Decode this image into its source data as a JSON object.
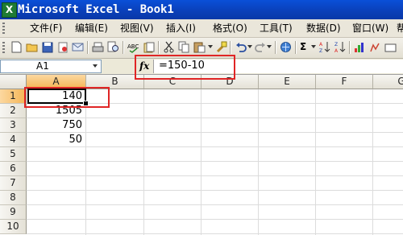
{
  "window": {
    "title": "Microsoft Excel - Book1",
    "app_icon_letter": "X"
  },
  "menu": {
    "items": [
      {
        "label": "文件(F)"
      },
      {
        "label": "编辑(E)"
      },
      {
        "label": "视图(V)"
      },
      {
        "label": "插入(I)"
      },
      {
        "label": "格式(O)"
      },
      {
        "label": "工具(T)"
      },
      {
        "label": "数据(D)"
      },
      {
        "label": "窗口(W)"
      },
      {
        "label": "帮"
      }
    ]
  },
  "toolbar": {
    "sum_symbol": "Σ"
  },
  "formula_bar": {
    "name_box": "A1",
    "fx_label": "fx",
    "formula": "=150-10"
  },
  "sheet": {
    "columns": [
      "A",
      "B",
      "C",
      "D",
      "E",
      "F",
      "G"
    ],
    "rows": [
      "1",
      "2",
      "3",
      "4",
      "5",
      "6",
      "7",
      "8",
      "9",
      "10"
    ],
    "cells": {
      "A1": "140",
      "A2": "1505",
      "A3": "750",
      "A4": "50"
    },
    "active_cell": "A1"
  },
  "highlight_color": "#e02525"
}
